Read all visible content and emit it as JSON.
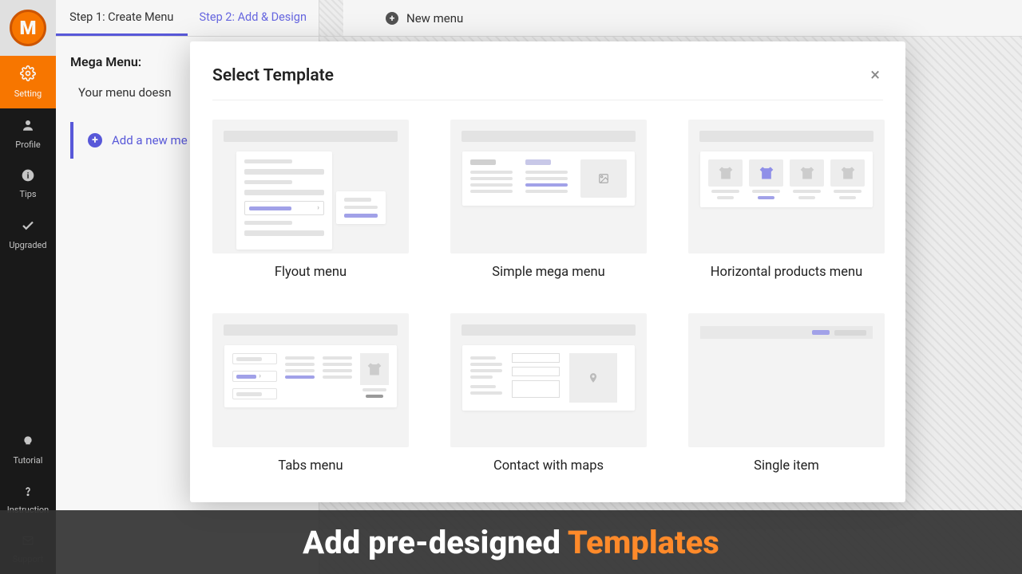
{
  "sidebar": {
    "items": [
      {
        "label": "Setting",
        "icon": "gear"
      },
      {
        "label": "Profile",
        "icon": "user"
      },
      {
        "label": "Tips",
        "icon": "info"
      },
      {
        "label": "Upgraded",
        "icon": "check"
      },
      {
        "label": "Tutorial",
        "icon": "bulb"
      },
      {
        "label": "Instruction",
        "icon": "question"
      },
      {
        "label": "Support",
        "icon": "mail"
      }
    ]
  },
  "steps": {
    "step1": "Step 1: Create Menu",
    "step2": "Step 2: Add & Design"
  },
  "topbar": {
    "new_menu": "New menu"
  },
  "leftpanel": {
    "title": "Mega Menu:",
    "empty_text": "Your menu doesn",
    "add_button": "Add a new me"
  },
  "modal": {
    "title": "Select Template",
    "close": "×",
    "templates": [
      {
        "label": "Flyout menu"
      },
      {
        "label": "Simple mega menu"
      },
      {
        "label": "Horizontal products menu"
      },
      {
        "label": "Tabs menu"
      },
      {
        "label": "Contact with maps"
      },
      {
        "label": "Single item"
      }
    ]
  },
  "banner": {
    "pre": "Add pre-designed ",
    "accent": "Templates"
  }
}
